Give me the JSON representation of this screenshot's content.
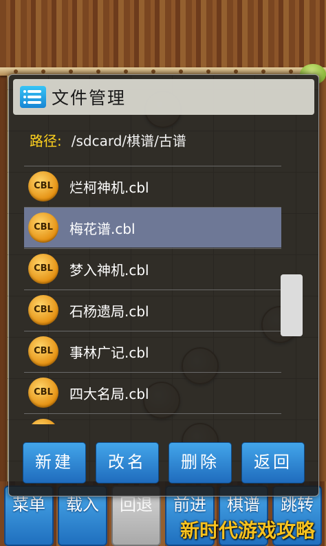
{
  "dialog": {
    "title": "文件管理",
    "path_label": "路径:",
    "path_value": "/sdcard/棋谱/古谱",
    "files": [
      {
        "icon_text": "CBL",
        "name": "烂柯神机.cbl",
        "selected": false
      },
      {
        "icon_text": "CBL",
        "name": "梅花谱.cbl",
        "selected": true
      },
      {
        "icon_text": "CBL",
        "name": "梦入神机.cbl",
        "selected": false
      },
      {
        "icon_text": "CBL",
        "name": "石杨遗局.cbl",
        "selected": false
      },
      {
        "icon_text": "CBL",
        "name": "事林广记.cbl",
        "selected": false
      },
      {
        "icon_text": "CBL",
        "name": "四大名局.cbl",
        "selected": false
      }
    ],
    "buttons": {
      "new": "新建",
      "rename": "改名",
      "delete": "删除",
      "back": "返回"
    }
  },
  "toolbar": {
    "menu": "菜单",
    "load": "载入",
    "undo": "回退",
    "forward": "前进",
    "manual": "棋谱",
    "jump": "跳转"
  },
  "watermark": "新时代游戏攻略",
  "colors": {
    "accent_blue": "#1f6cbd",
    "path_label": "#ffd21e",
    "selected_row": "#6e7896",
    "icon_gold": "#e48f10"
  }
}
